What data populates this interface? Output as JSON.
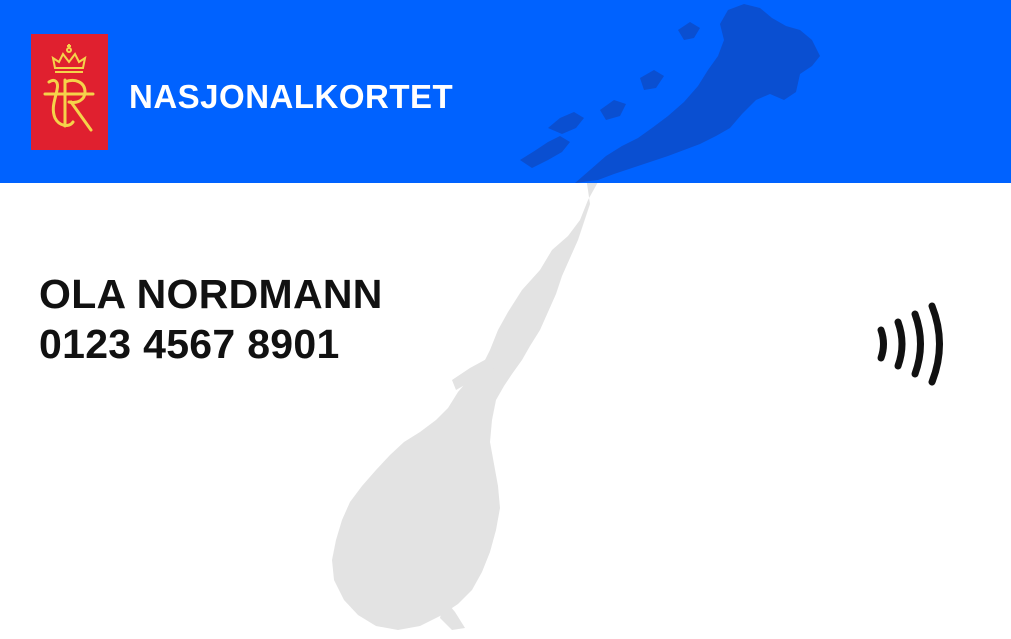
{
  "card": {
    "title": "NASJONALKORTET",
    "holder_name": "OLA NORDMANN",
    "card_number": "0123 4567 8901"
  },
  "icons": {
    "emblem": "coat-of-arms-icon",
    "contactless": "contactless-icon",
    "map": "norway-map-icon"
  },
  "colors": {
    "header_blue": "#0062ff",
    "emblem_red": "#e0202f",
    "emblem_gold": "#f5d34a",
    "map_grey": "#e3e3e3",
    "text_dark": "#111111"
  }
}
